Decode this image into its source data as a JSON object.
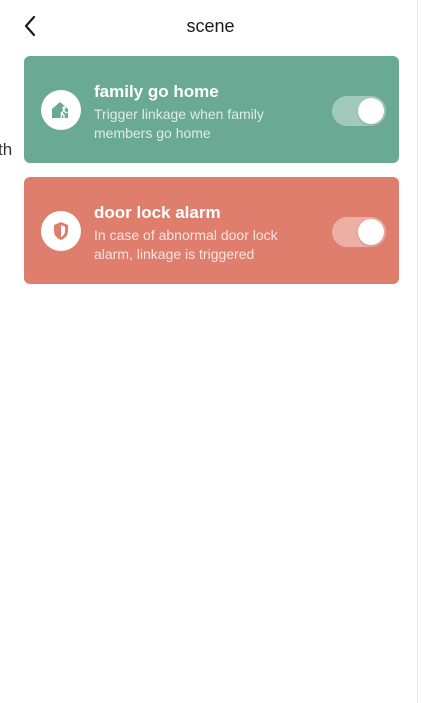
{
  "header": {
    "title": "scene",
    "back_icon": "chevron-left-icon"
  },
  "edge_text": "th",
  "scenes": [
    {
      "title": "family go home",
      "description": "Trigger linkage when family members go home",
      "icon": "home-walk-icon",
      "color": "#6aa994",
      "enabled": true
    },
    {
      "title": "door lock alarm",
      "description": "In case of abnormal door lock alarm, linkage is triggered",
      "icon": "shield-icon",
      "color": "#df7e6c",
      "enabled": true
    }
  ]
}
